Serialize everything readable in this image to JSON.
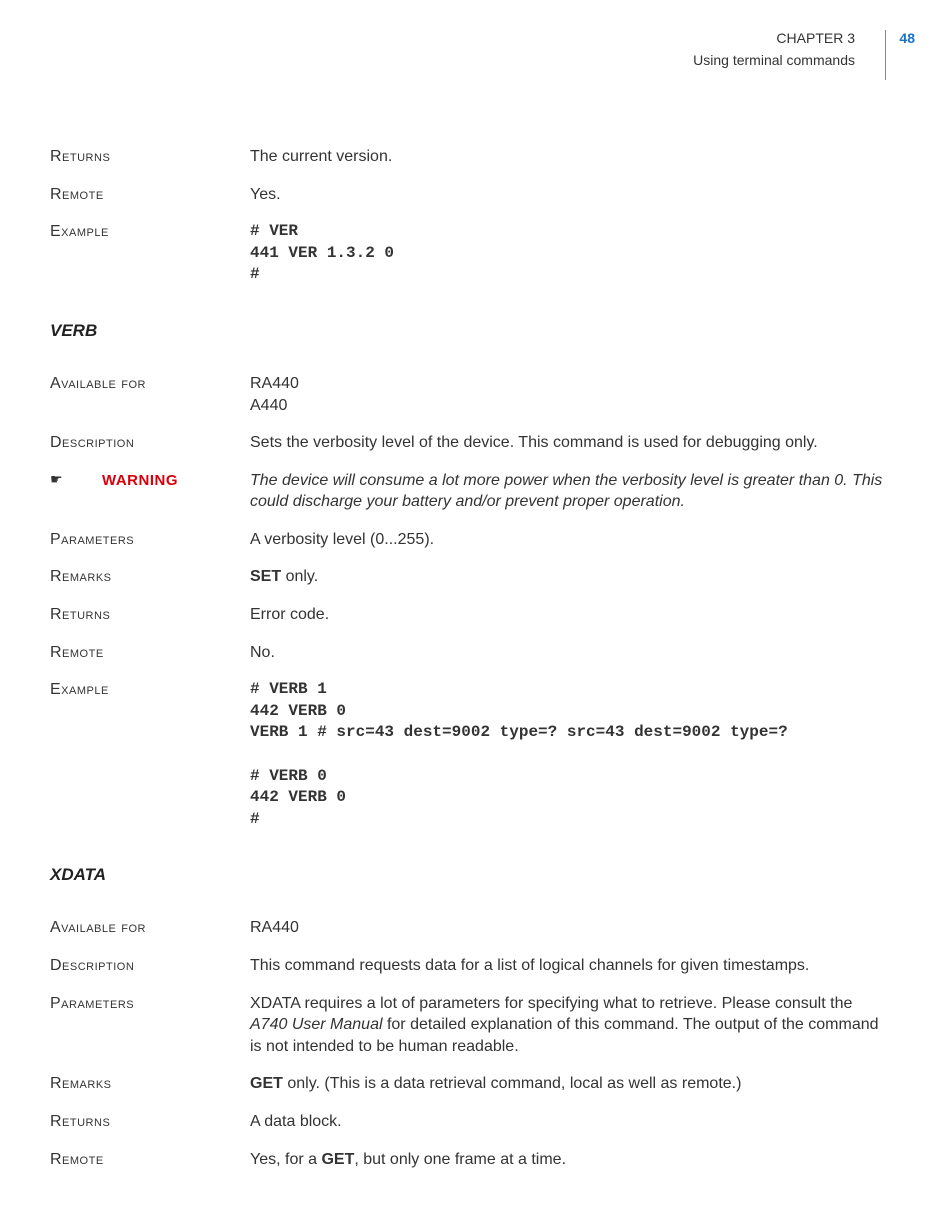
{
  "header": {
    "chapter": "CHAPTER 3",
    "subheading": "Using terminal commands",
    "page_number": "48"
  },
  "sections": [
    {
      "rows": [
        {
          "label": "Returns",
          "text": "The current version."
        },
        {
          "label": "Remote",
          "text": "Yes."
        },
        {
          "label": "Example",
          "code": "# VER\n441 VER 1.3.2 0\n#"
        }
      ]
    }
  ],
  "verb": {
    "title": "VERB",
    "available_for_label": "Available for",
    "available_for": "RA440\nA440",
    "description_label": "Description",
    "description": "Sets the verbosity level of the device. This command is used for debugging only.",
    "warning_icon": "☛",
    "warning_label": "WARNING",
    "warning_text": "The device will consume a lot more power when the verbosity level is greater than 0. This could discharge your battery and/or prevent proper operation.",
    "parameters_label": "Parameters",
    "parameters": "A verbosity level (0...255).",
    "remarks_label": "Remarks",
    "remarks_bold": "SET",
    "remarks_rest": " only.",
    "returns_label": "Returns",
    "returns": "Error code.",
    "remote_label": "Remote",
    "remote": "No.",
    "example_label": "Example",
    "example": "# VERB 1\n442 VERB 0\nVERB 1 # src=43 dest=9002 type=? src=43 dest=9002 type=?\n\n# VERB 0\n442 VERB 0\n#"
  },
  "xdata": {
    "title": "XDATA",
    "available_for_label": "Available for",
    "available_for": "RA440",
    "description_label": "Description",
    "description": "This command requests data for a list of logical channels for given timestamps.",
    "parameters_label": "Parameters",
    "parameters_pre": "XDATA requires a lot of parameters for specifying what to retrieve. Please consult the ",
    "parameters_ital": "A740 User Manual",
    "parameters_post": " for detailed explanation of this command. The output of the command is not intended to be human readable.",
    "remarks_label": "Remarks",
    "remarks_bold": "GET",
    "remarks_rest": " only. (This is a data retrieval command, local as well as remote.)",
    "returns_label": "Returns",
    "returns": "A data block.",
    "remote_label": "Remote",
    "remote_pre": "Yes, for a ",
    "remote_bold": "GET",
    "remote_post": ", but only one frame at a time."
  }
}
